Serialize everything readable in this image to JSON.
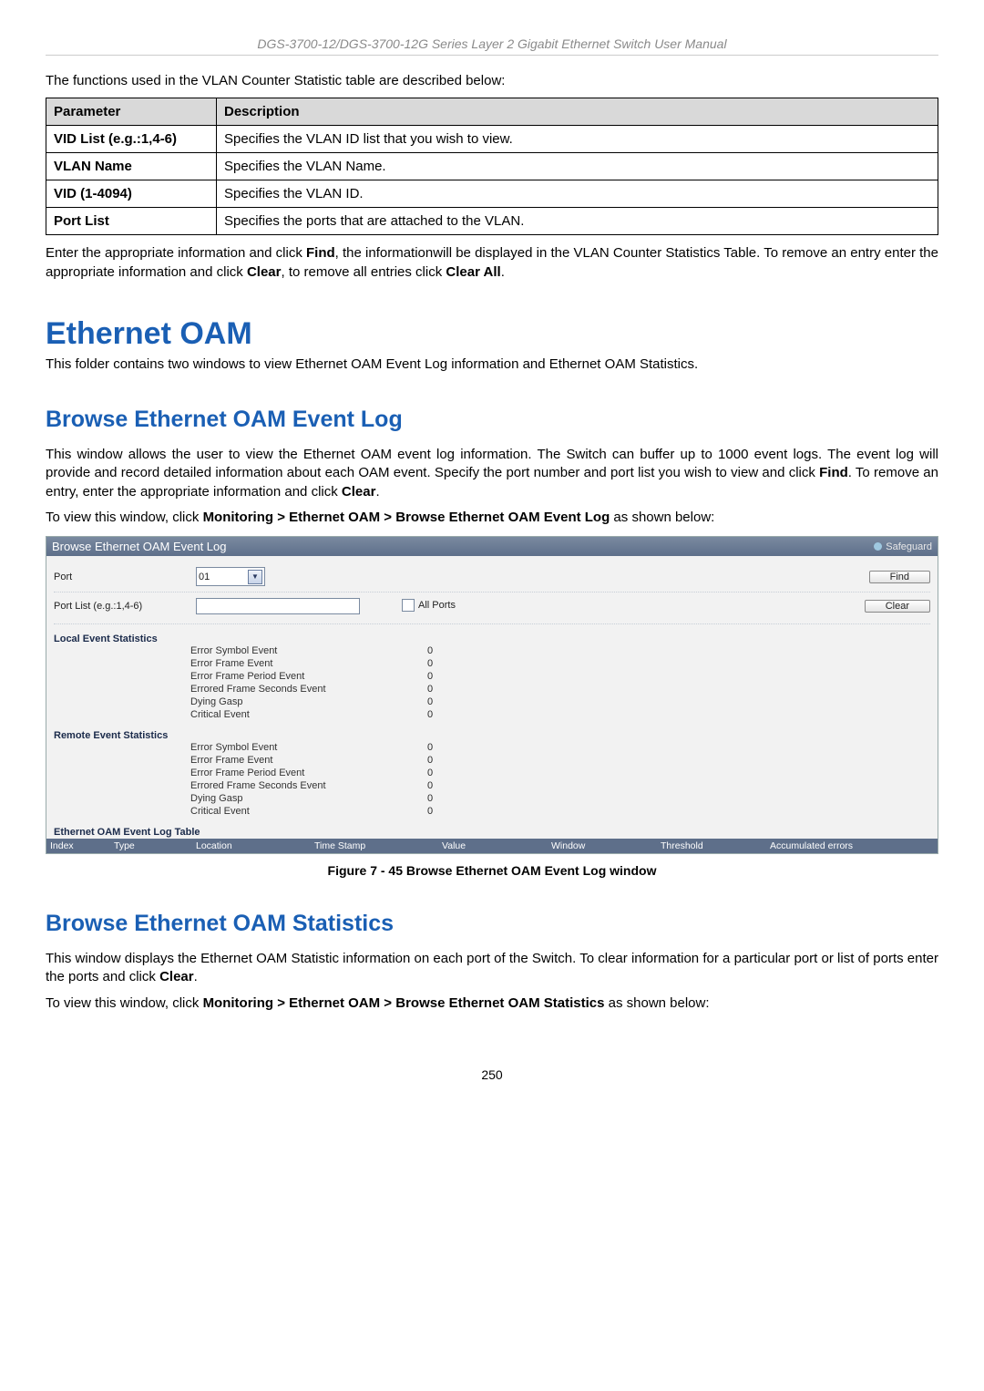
{
  "header": "DGS-3700-12/DGS-3700-12G Series Layer 2 Gigabit Ethernet Switch User Manual",
  "intro_line": "The functions used in the VLAN Counter Statistic table are described below:",
  "param_table": {
    "headers": {
      "col1": "Parameter",
      "col2": "Description"
    },
    "rows": [
      {
        "param": "VID List (e.g.:1,4-6)",
        "desc": "Specifies the VLAN ID list that you wish to view."
      },
      {
        "param": "VLAN Name",
        "desc": "Specifies the VLAN Name."
      },
      {
        "param": "VID (1-4094)",
        "desc": "Specifies the VLAN ID."
      },
      {
        "param": "Port List",
        "desc": "Specifies the ports that are attached to the VLAN."
      }
    ]
  },
  "after_table": {
    "p1a": "Enter the appropriate information and click ",
    "p1b": "Find",
    "p1c": ", the informationwill be displayed in the VLAN Counter Statistics Table. To remove an entry enter the appropriate information and click ",
    "p1d": "Clear",
    "p1e": ", to remove all entries click ",
    "p1f": "Clear All",
    "p1g": "."
  },
  "h1": "Ethernet OAM",
  "h1_sub": "This folder contains two windows to view Ethernet OAM Event Log information and Ethernet OAM Statistics.",
  "h2a": "Browse Ethernet OAM Event Log",
  "h2a_p1": "This window allows the user to view the Ethernet OAM event log information. The Switch can buffer up to 1000 event logs. The event log will provide and record detailed information about each OAM event. Specify the port number and port list you wish to view and click ",
  "h2a_p1_find": "Find",
  "h2a_p1_mid": ". To remove an entry, enter the appropriate information and click ",
  "h2a_p1_clear": "Clear",
  "h2a_p1_end": ".",
  "h2a_p2a": "To view this window, click ",
  "h2a_p2b": "Monitoring > Ethernet OAM > Browse Ethernet OAM Event Log",
  "h2a_p2c": " as shown below:",
  "screenshot": {
    "title": "Browse Ethernet OAM Event Log",
    "safeguard": "Safeguard",
    "row_port_label": "Port",
    "row_port_value": "01",
    "btn_find": "Find",
    "row_portlist_label": "Port List (e.g.:1,4-6)",
    "chk_allports": "All Ports",
    "btn_clear": "Clear",
    "local_heading": "Local Event Statistics",
    "remote_heading": "Remote Event Statistics",
    "stat_labels": [
      "Error Symbol Event",
      "Error Frame Event",
      "Error Frame Period Event",
      "Errored Frame Seconds Event",
      "Dying Gasp",
      "Critical Event"
    ],
    "stat_values_local": [
      "0",
      "0",
      "0",
      "0",
      "0",
      "0"
    ],
    "stat_values_remote": [
      "0",
      "0",
      "0",
      "0",
      "0",
      "0"
    ],
    "log_table_title": "Ethernet OAM Event Log Table",
    "log_headers": [
      "Index",
      "Type",
      "Location",
      "Time Stamp",
      "Value",
      "Window",
      "Threshold",
      "Accumulated errors"
    ]
  },
  "figure_caption": "Figure 7 - 45 Browse Ethernet OAM Event Log window",
  "h2b": "Browse Ethernet OAM Statistics",
  "h2b_p1": "This window displays the Ethernet OAM Statistic information on each port of the Switch. To clear information for a particular port or list of ports enter the ports and click ",
  "h2b_p1_clear": "Clear",
  "h2b_p1_end": ".",
  "h2b_p2a": "To view this window, click ",
  "h2b_p2b": "Monitoring > Ethernet OAM > Browse Ethernet OAM Statistics",
  "h2b_p2c": " as shown below:",
  "page_number": "250"
}
